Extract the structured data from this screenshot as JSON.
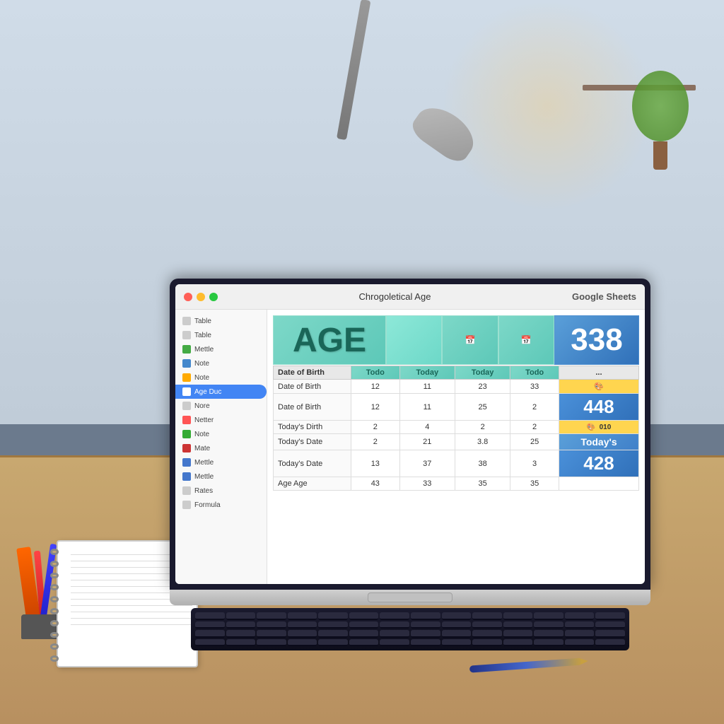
{
  "window": {
    "title": "Chronological Age — Google Sheets",
    "title_short": "Chrogoletical Age",
    "google_sheets": "Google Sheets",
    "traffic_lights": {
      "red": "#ff5f57",
      "yellow": "#febc2e",
      "green": "#28c840"
    }
  },
  "sidebar": {
    "items": [
      {
        "label": "Table",
        "color": "#cccccc",
        "active": false
      },
      {
        "label": "Table",
        "color": "#cccccc",
        "active": false
      },
      {
        "label": "Mettle",
        "color": "#44aa44",
        "active": false
      },
      {
        "label": "Note",
        "color": "#4488cc",
        "active": false
      },
      {
        "label": "Note",
        "color": "#ffaa00",
        "active": false
      },
      {
        "label": "Age Duc",
        "color": "#4285f4",
        "active": true
      },
      {
        "label": "Nore",
        "color": "#cccccc",
        "active": false
      },
      {
        "label": "Netter",
        "color": "#ff5555",
        "active": false
      },
      {
        "label": "Note",
        "color": "#33aa33",
        "active": false
      },
      {
        "label": "Mate",
        "color": "#cc3333",
        "active": false
      },
      {
        "label": "Mettle",
        "color": "#4477cc",
        "active": false
      },
      {
        "label": "Mettle",
        "color": "#4477cc",
        "active": false
      },
      {
        "label": "Rates",
        "color": "#cccccc",
        "active": false
      },
      {
        "label": "Formula",
        "color": "#cccccc",
        "active": false
      }
    ]
  },
  "spreadsheet": {
    "header_big": "AGE",
    "header_number": "338",
    "header_number2": "448",
    "header_number3": "428",
    "columns": [
      "Date of Birth",
      "Todo",
      "Today",
      "Today",
      "Todo",
      "..."
    ],
    "rows": [
      {
        "label": "Date of Birth",
        "values": [
          "12",
          "11",
          "23",
          "33"
        ],
        "highlight": "yellow",
        "extra": "..."
      },
      {
        "label": "Date of Birth",
        "values": [
          "12",
          "11",
          "25",
          "2"
        ],
        "highlight": "blue-big",
        "extra": "448"
      },
      {
        "label": "Today's Dirth",
        "values": [
          "2",
          "4",
          "2",
          "2"
        ],
        "highlight": "green",
        "extra": "..."
      },
      {
        "label": "Today's Date",
        "values": [
          "2",
          "21",
          "3.8",
          "25"
        ],
        "highlight": "today-blue",
        "extra": "Today's"
      },
      {
        "label": "Today's Date",
        "values": [
          "13",
          "37",
          "38",
          "3"
        ],
        "highlight": "green-big",
        "extra": "428"
      },
      {
        "label": "Age Age",
        "values": [
          "43",
          "33",
          "35",
          "35"
        ],
        "highlight": null,
        "extra": ""
      }
    ]
  }
}
